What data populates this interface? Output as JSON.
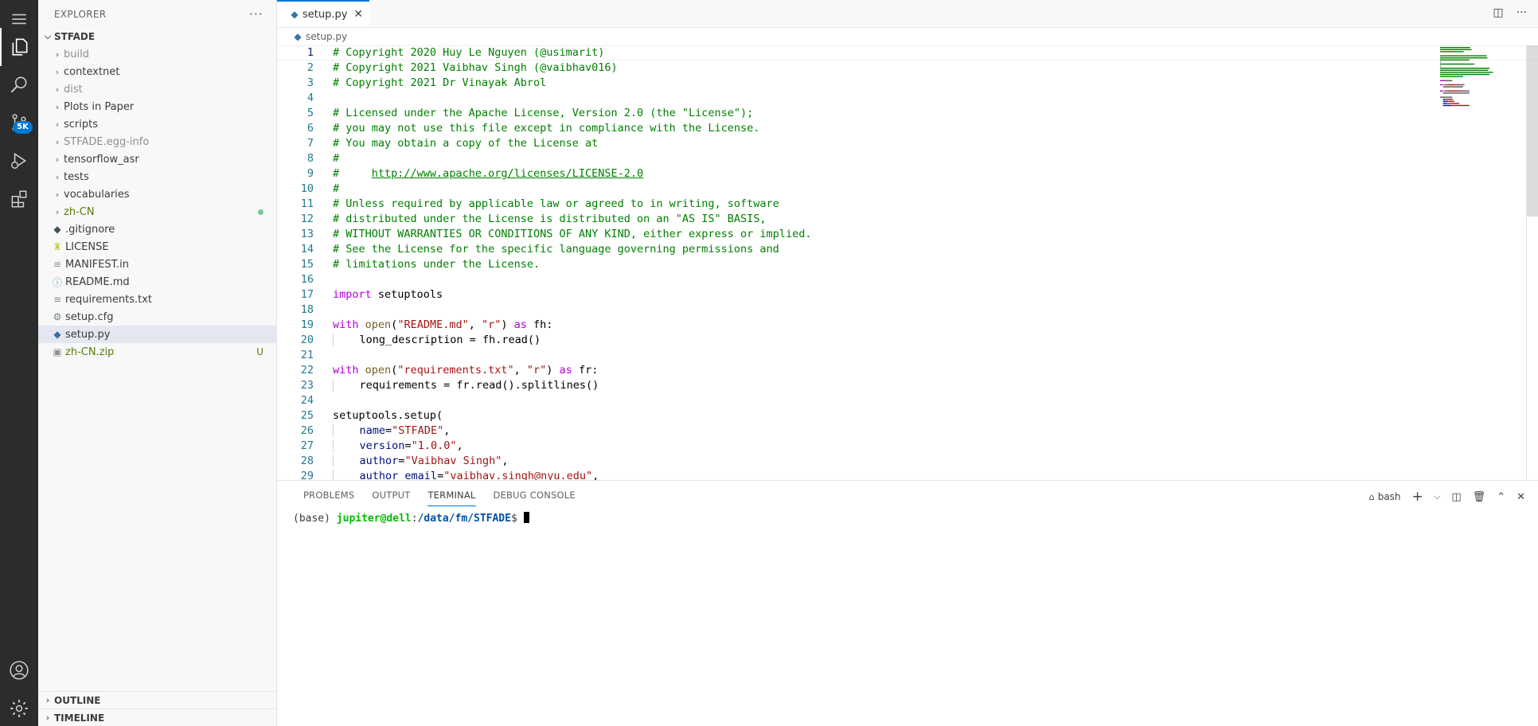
{
  "activity_bar": {
    "scm_badge": "5K",
    "items": [
      "menu-icon",
      "explorer-icon",
      "search-icon",
      "source-control-icon",
      "run-debug-icon",
      "extensions-icon",
      "account-icon",
      "manage-gear-icon"
    ]
  },
  "sidebar": {
    "title": "EXPLORER",
    "more": "···",
    "root": "STFADE",
    "folders": [
      {
        "name": "build",
        "color": "gray"
      },
      {
        "name": "contextnet",
        "color": "norm"
      },
      {
        "name": "dist",
        "color": "gray"
      },
      {
        "name": "Plots in Paper",
        "color": "norm"
      },
      {
        "name": "scripts",
        "color": "norm"
      },
      {
        "name": "STFADE.egg-info",
        "color": "gray"
      },
      {
        "name": "tensorflow_asr",
        "color": "norm"
      },
      {
        "name": "tests",
        "color": "norm"
      },
      {
        "name": "vocabularies",
        "color": "norm"
      },
      {
        "name": "zh-CN",
        "color": "green",
        "status": "dot"
      }
    ],
    "files": [
      {
        "name": ".gitignore",
        "icon": "git-icon"
      },
      {
        "name": "LICENSE",
        "icon": "license-icon"
      },
      {
        "name": "MANIFEST.in",
        "icon": "lines-icon"
      },
      {
        "name": "README.md",
        "icon": "info-icon"
      },
      {
        "name": "requirements.txt",
        "icon": "lines-icon"
      },
      {
        "name": "setup.cfg",
        "icon": "gear-icon"
      },
      {
        "name": "setup.py",
        "icon": "python-icon",
        "selected": true
      },
      {
        "name": "zh-CN.zip",
        "icon": "zip-icon",
        "status": "U",
        "color": "green"
      }
    ],
    "outline": "OUTLINE",
    "timeline": "TIMELINE"
  },
  "editor": {
    "tab_label": "setup.py",
    "tab_close": "✕",
    "breadcrumb": "setup.py",
    "lines": [
      [
        [
          "cmt",
          "# Copyright 2020 Huy Le Nguyen (@usimarit)"
        ]
      ],
      [
        [
          "cmt",
          "# Copyright 2021 Vaibhav Singh (@vaibhav016)"
        ]
      ],
      [
        [
          "cmt",
          "# Copyright 2021 Dr Vinayak Abrol"
        ]
      ],
      [],
      [
        [
          "cmt",
          "# Licensed under the Apache License, Version 2.0 (the \"License\");"
        ]
      ],
      [
        [
          "cmt",
          "# you may not use this file except in compliance with the License."
        ]
      ],
      [
        [
          "cmt",
          "# You may obtain a copy of the License at"
        ]
      ],
      [
        [
          "cmt",
          "#"
        ]
      ],
      [
        [
          "cmt",
          "#     "
        ],
        [
          "link",
          "http://www.apache.org/licenses/LICENSE-2.0"
        ]
      ],
      [
        [
          "cmt",
          "#"
        ]
      ],
      [
        [
          "cmt",
          "# Unless required by applicable law or agreed to in writing, software"
        ]
      ],
      [
        [
          "cmt",
          "# distributed under the License is distributed on an \"AS IS\" BASIS,"
        ]
      ],
      [
        [
          "cmt",
          "# WITHOUT WARRANTIES OR CONDITIONS OF ANY KIND, either express or implied."
        ]
      ],
      [
        [
          "cmt",
          "# See the License for the specific language governing permissions and"
        ]
      ],
      [
        [
          "cmt",
          "# limitations under the License."
        ]
      ],
      [],
      [
        [
          "kw",
          "import"
        ],
        [
          "plain",
          " setuptools"
        ]
      ],
      [],
      [
        [
          "kw",
          "with"
        ],
        [
          "plain",
          " "
        ],
        [
          "fn",
          "open"
        ],
        [
          "plain",
          "("
        ],
        [
          "str",
          "\"README.md\""
        ],
        [
          "plain",
          ", "
        ],
        [
          "str",
          "\"r\""
        ],
        [
          "plain",
          ") "
        ],
        [
          "kw",
          "as"
        ],
        [
          "plain",
          " fh:"
        ]
      ],
      [
        [
          "indent",
          "    "
        ],
        [
          "plain",
          "long_description = fh.read()"
        ]
      ],
      [],
      [
        [
          "kw",
          "with"
        ],
        [
          "plain",
          " "
        ],
        [
          "fn",
          "open"
        ],
        [
          "plain",
          "("
        ],
        [
          "str",
          "\"requirements.txt\""
        ],
        [
          "plain",
          ", "
        ],
        [
          "str",
          "\"r\""
        ],
        [
          "plain",
          ") "
        ],
        [
          "kw",
          "as"
        ],
        [
          "plain",
          " fr:"
        ]
      ],
      [
        [
          "indent",
          "    "
        ],
        [
          "plain",
          "requirements = fr.read().splitlines()"
        ]
      ],
      [],
      [
        [
          "plain",
          "setuptools.setup("
        ]
      ],
      [
        [
          "indent",
          "    "
        ],
        [
          "var",
          "name"
        ],
        [
          "plain",
          "="
        ],
        [
          "str",
          "\"STFADE\""
        ],
        [
          "plain",
          ","
        ]
      ],
      [
        [
          "indent",
          "    "
        ],
        [
          "var",
          "version"
        ],
        [
          "plain",
          "="
        ],
        [
          "str",
          "\"1.0.0\""
        ],
        [
          "plain",
          ","
        ]
      ],
      [
        [
          "indent",
          "    "
        ],
        [
          "var",
          "author"
        ],
        [
          "plain",
          "="
        ],
        [
          "str",
          "\"Vaibhav Singh\""
        ],
        [
          "plain",
          ","
        ]
      ],
      [
        [
          "indent",
          "    "
        ],
        [
          "var",
          "author_email"
        ],
        [
          "plain",
          "="
        ],
        [
          "str",
          "\"vaibhav.singh@nyu.edu\""
        ],
        [
          "plain",
          ","
        ]
      ]
    ]
  },
  "panel": {
    "tabs": [
      "PROBLEMS",
      "OUTPUT",
      "TERMINAL",
      "DEBUG CONSOLE"
    ],
    "active_tab": "TERMINAL",
    "shell": "bash",
    "prompt_env": "(base) ",
    "prompt_user": "jupiter@dell",
    "prompt_colon": ":",
    "prompt_path": "/data/fm/STFADE",
    "prompt_end": "$ "
  }
}
